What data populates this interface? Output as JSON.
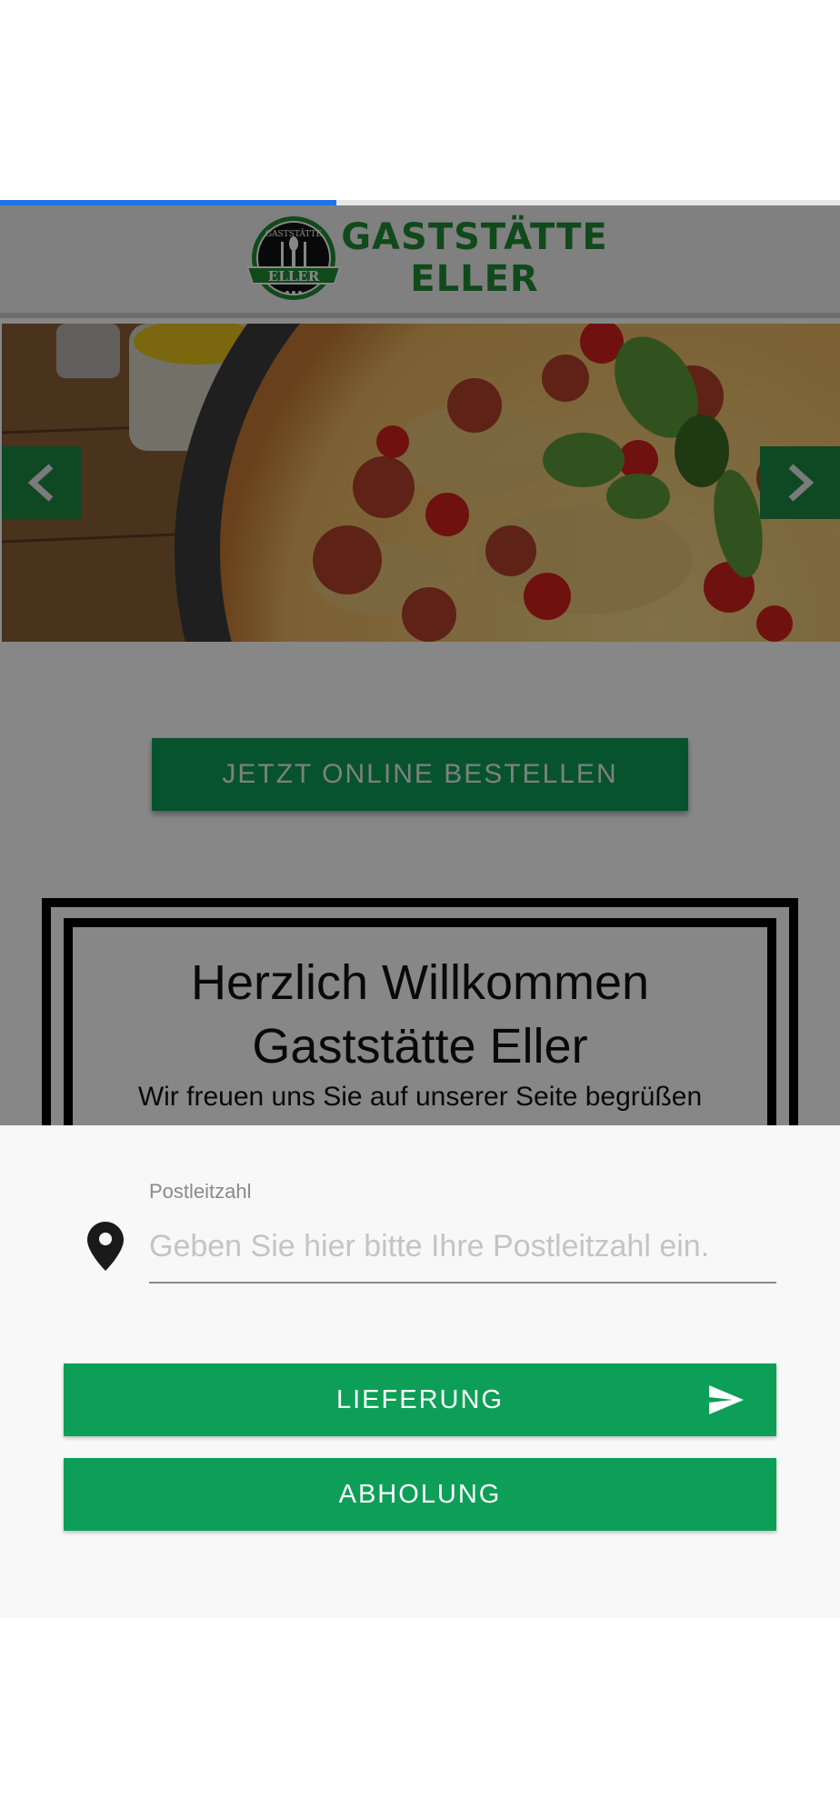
{
  "progress": {
    "value_percent": 40,
    "color": "#1e74e8"
  },
  "header": {
    "logo_title": "GASTSTÄTTE\nELLER",
    "seal_top": "GASTSTÄTTE",
    "seal_bottom": "ELLER",
    "brand_color": "#1f8c34"
  },
  "slider": {
    "prev_icon": "chevron-left-icon",
    "next_icon": "chevron-right-icon"
  },
  "main": {
    "order_button": "JETZT ONLINE BESTELLEN",
    "welcome_title": "Herzlich Willkommen\nGaststätte Eller",
    "welcome_subtitle": "Wir freuen uns Sie auf unserer Seite begrüßen"
  },
  "sheet": {
    "zip_label": "Postleitzahl",
    "zip_placeholder": "Geben Sie hier bitte Ihre Postleitzahl ein.",
    "zip_value": "",
    "delivery_button": "LIEFERUNG",
    "pickup_button": "ABHOLUNG",
    "accent_color": "#0d9f57"
  }
}
